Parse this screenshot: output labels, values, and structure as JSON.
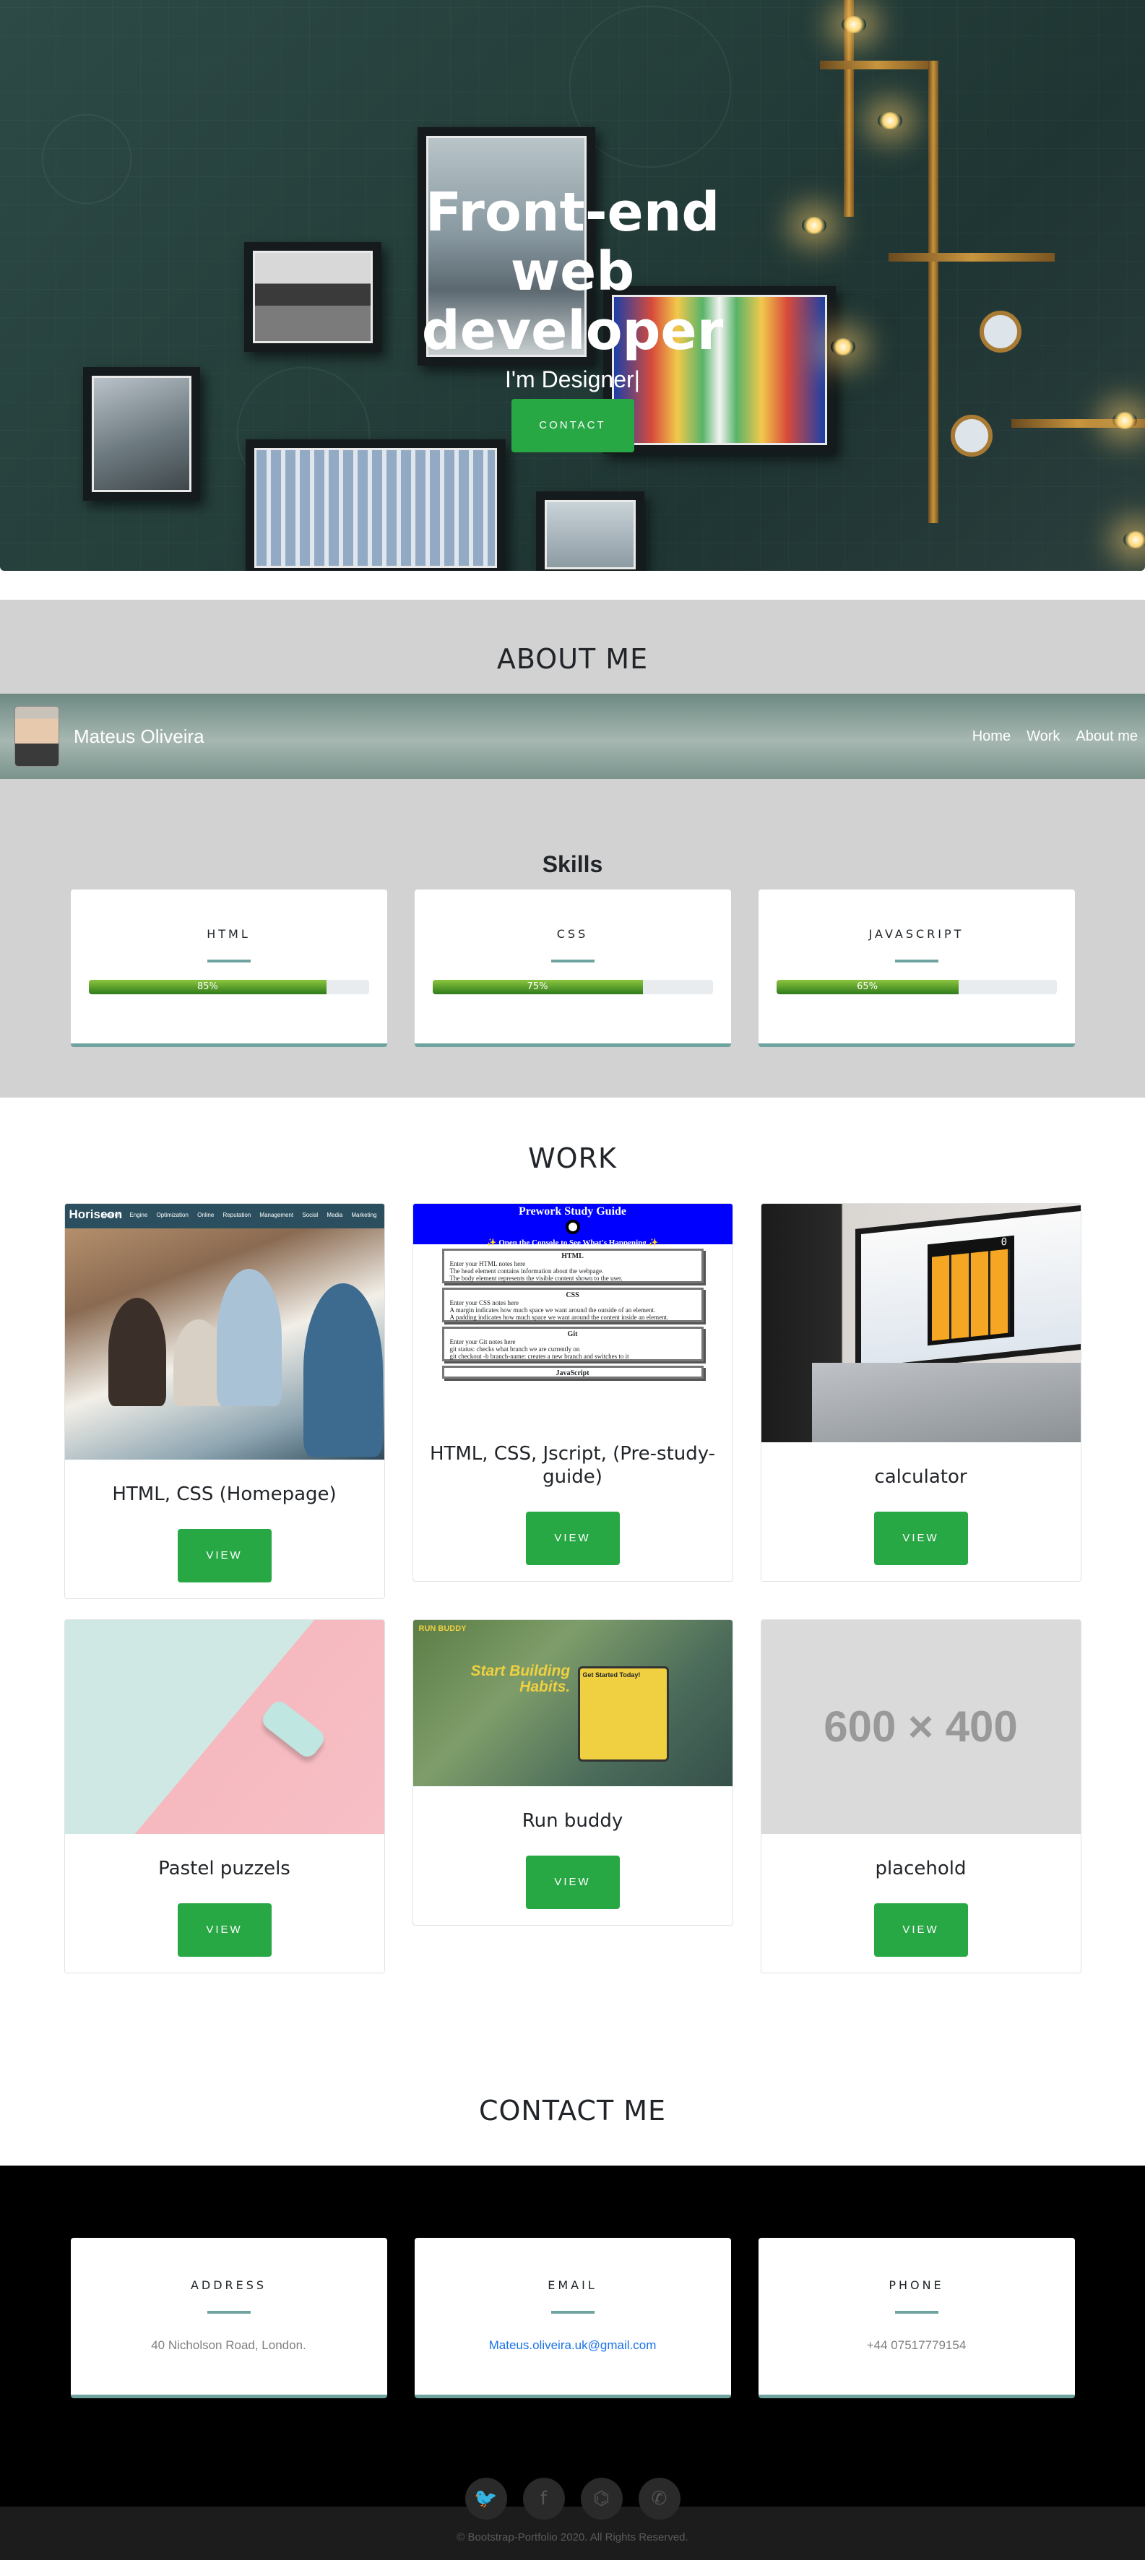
{
  "hero": {
    "title": "Front-end web developer",
    "subtitle": "I'm Designer|",
    "contact_button": "CONTACT"
  },
  "about": {
    "section_title": "ABOUT ME",
    "navbar": {
      "brand": "Mateus Oliveira",
      "links": [
        "Home",
        "Work",
        "About me"
      ]
    },
    "skills_title": "Skills",
    "skills": [
      {
        "name": "HTML",
        "percent_label": "85%",
        "percent": 85
      },
      {
        "name": "CSS",
        "percent_label": "75%",
        "percent": 75
      },
      {
        "name": "JAVASCRIPT",
        "percent_label": "65%",
        "percent": 65
      }
    ]
  },
  "work": {
    "section_title": "WORK",
    "projects": [
      {
        "title": "HTML, CSS (Homepage)",
        "button": "VIEW",
        "thumb": {
          "logo": "Horiseon",
          "nav": "Search Engine Optimization Online Reputation Management Social Media Marketing"
        }
      },
      {
        "title": "HTML, CSS, Jscript, (Pre-study-guide)",
        "button": "VIEW",
        "thumb": {
          "heading": "Prework Study Guide",
          "banner": "✨ Open the Console to See What's Happening ✨",
          "boxes": [
            {
              "title": "HTML",
              "lines": [
                "Enter your HTML notes here",
                "The head element contains information about the webpage.",
                "The body element represents the visible content shown to the user."
              ]
            },
            {
              "title": "CSS",
              "lines": [
                "Enter your CSS notes here",
                "A margin indicates how much space we want around the outside of an element.",
                "A padding indicates how much space we want around the content inside an element."
              ]
            },
            {
              "title": "Git",
              "lines": [
                "Enter your Git notes here",
                "git status: checks what branch we are currently on",
                "git checkout -b branch-name: creates a new branch and switches to it"
              ]
            },
            {
              "title": "JavaScript",
              "lines": []
            }
          ]
        }
      },
      {
        "title": "calculator",
        "button": "VIEW",
        "thumb": {
          "display": "0"
        }
      },
      {
        "title": "Pastel puzzels",
        "button": "VIEW"
      },
      {
        "title": "Run buddy",
        "button": "VIEW",
        "thumb": {
          "logo": "RUN BUDDY",
          "headline": [
            "Start Building",
            "Habits."
          ],
          "form_title": "Get Started Today!"
        }
      },
      {
        "title": "placehold",
        "button": "VIEW",
        "thumb": {
          "text": "600 × 400"
        }
      }
    ]
  },
  "contact": {
    "section_title": "CONTACT ME",
    "cards": [
      {
        "label": "ADDRESS",
        "value": "40 Nicholson Road, London."
      },
      {
        "label": "EMAIL",
        "value": "Mateus.oliveira.uk@gmail.com"
      },
      {
        "label": "PHONE",
        "value": "+44 07517779154"
      }
    ],
    "socials": [
      {
        "name": "twitter-icon",
        "glyph": "🐦"
      },
      {
        "name": "facebook-icon",
        "glyph": "f"
      },
      {
        "name": "github-icon",
        "glyph": "⌬"
      },
      {
        "name": "whatsapp-icon",
        "glyph": "✆"
      }
    ]
  },
  "footer": {
    "copyright": "© Bootstrap-Portfolio 2020. All Rights Reserved."
  },
  "colors": {
    "accent_green": "#28a745",
    "teal_rule": "#6ea3a0",
    "about_bg": "#d2d2d2",
    "contact_bg": "#000000",
    "footer_bg": "#1c1c1c"
  }
}
